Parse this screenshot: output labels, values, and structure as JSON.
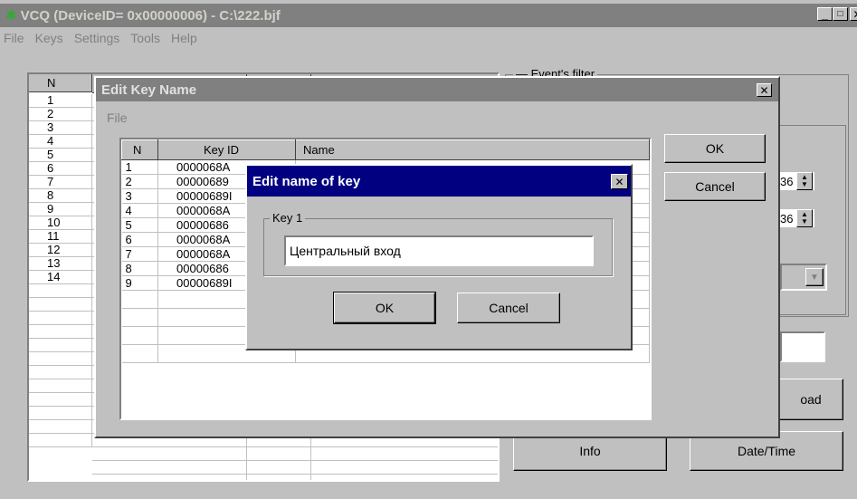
{
  "main_window": {
    "title": "VCQ (DeviceID= 0x00000006) - C:\\222.bjf",
    "menu": [
      "File",
      "Keys",
      "Settings",
      "Tools",
      "Help"
    ],
    "grid_header": "N",
    "row_numbers": [
      "1",
      "2",
      "3",
      "4",
      "5",
      "6",
      "7",
      "8",
      "9",
      "10",
      "11",
      "12",
      "13",
      "14"
    ],
    "filter_label": "Event's filter",
    "spin1_value": "36",
    "spin2_value": "36",
    "load_button": "oad",
    "info_button": "Info",
    "datetime_button": "Date/Time"
  },
  "edit_key_dialog": {
    "title": "Edit Key Name",
    "menu_file": "File",
    "columns": [
      "N",
      "Key ID",
      "Name"
    ],
    "rows": [
      {
        "n": "1",
        "key_id": "0000068A",
        "name": ""
      },
      {
        "n": "2",
        "key_id": "00000689",
        "name": ""
      },
      {
        "n": "3",
        "key_id": "00000689I",
        "name": ""
      },
      {
        "n": "4",
        "key_id": "0000068A",
        "name": ""
      },
      {
        "n": "5",
        "key_id": "00000686",
        "name": ""
      },
      {
        "n": "6",
        "key_id": "0000068A",
        "name": ""
      },
      {
        "n": "7",
        "key_id": "0000068A",
        "name": ""
      },
      {
        "n": "8",
        "key_id": "00000686",
        "name": ""
      },
      {
        "n": "9",
        "key_id": "00000689I",
        "name": ""
      }
    ],
    "ok": "OK",
    "cancel": "Cancel"
  },
  "edit_name_dialog": {
    "title": "Edit name of key",
    "group_label": "Key 1",
    "name_value": "Центральный вход",
    "ok": "OK",
    "cancel": "Cancel"
  },
  "colors": {
    "titlebar_active": "#000080",
    "titlebar_inactive": "#808080",
    "face": "#c0c0c0"
  }
}
